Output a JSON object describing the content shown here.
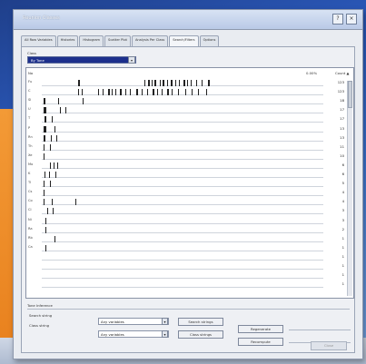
{
  "window": {
    "title": "Reunion Classes"
  },
  "tabs": [
    {
      "label": "All Row Variables"
    },
    {
      "label": "Histories"
    },
    {
      "label": "Histogram"
    },
    {
      "label": "Scatter Plot"
    },
    {
      "label": "Analysis Per Class"
    },
    {
      "label": "Search/Filters",
      "active": true
    },
    {
      "label": "Options"
    }
  ],
  "class_selector": {
    "label": "Class",
    "selected": "By Tone"
  },
  "grid": {
    "col_label": "No",
    "col_pct": "0.00%",
    "col_count": "Count ▲",
    "rows": [
      {
        "label": "Fu",
        "count": "123",
        "ticks": [
          [
            40,
            2
          ],
          [
            113,
            1
          ],
          [
            117,
            2
          ],
          [
            121,
            1
          ],
          [
            124,
            2
          ],
          [
            130,
            1
          ],
          [
            133,
            2
          ],
          [
            138,
            1
          ],
          [
            142,
            2
          ],
          [
            147,
            1
          ],
          [
            151,
            1
          ],
          [
            156,
            2
          ],
          [
            160,
            1
          ],
          [
            164,
            1
          ],
          [
            170,
            1
          ],
          [
            176,
            1
          ],
          [
            183,
            2
          ]
        ]
      },
      {
        "label": "C",
        "count": "123",
        "ticks": [
          [
            40,
            1
          ],
          [
            44,
            1
          ],
          [
            62,
            1
          ],
          [
            67,
            1
          ],
          [
            73,
            2
          ],
          [
            77,
            1
          ],
          [
            81,
            1
          ],
          [
            86,
            2
          ],
          [
            92,
            1
          ],
          [
            97,
            1
          ],
          [
            104,
            2
          ],
          [
            110,
            1
          ],
          [
            116,
            1
          ],
          [
            122,
            2
          ],
          [
            127,
            1
          ],
          [
            132,
            1
          ],
          [
            138,
            2
          ],
          [
            143,
            1
          ],
          [
            150,
            1
          ],
          [
            158,
            1
          ],
          [
            165,
            1
          ],
          [
            172,
            1
          ],
          [
            181,
            1
          ]
        ]
      },
      {
        "label": "Sl",
        "count": "18",
        "ticks": [
          [
            2,
            2
          ],
          [
            18,
            1
          ],
          [
            45,
            1
          ]
        ]
      },
      {
        "label": "U",
        "count": "17",
        "ticks": [
          [
            2,
            3
          ],
          [
            20,
            1
          ],
          [
            26,
            1
          ]
        ]
      },
      {
        "label": "T",
        "count": "17",
        "ticks": [
          [
            3,
            2
          ],
          [
            11,
            1
          ]
        ]
      },
      {
        "label": "P",
        "count": "13",
        "ticks": [
          [
            2,
            3
          ],
          [
            14,
            1
          ]
        ]
      },
      {
        "label": "Rn",
        "count": "13",
        "ticks": [
          [
            2,
            2
          ],
          [
            10,
            1
          ],
          [
            16,
            1
          ]
        ]
      },
      {
        "label": "Th",
        "count": "11",
        "ticks": [
          [
            2,
            1
          ],
          [
            9,
            1
          ]
        ]
      },
      {
        "label": "Xe",
        "count": "10",
        "ticks": [
          [
            2,
            1
          ]
        ]
      },
      {
        "label": "Mo",
        "count": "6",
        "ticks": [
          [
            9,
            1
          ],
          [
            13,
            1
          ],
          [
            17,
            1
          ]
        ]
      },
      {
        "label": "K",
        "count": "6",
        "ticks": [
          [
            3,
            1
          ],
          [
            8,
            1
          ],
          [
            15,
            1
          ]
        ]
      },
      {
        "label": "Tl",
        "count": "5",
        "ticks": [
          [
            2,
            1
          ],
          [
            9,
            1
          ]
        ]
      },
      {
        "label": "Cs",
        "count": "4",
        "ticks": [
          [
            2,
            1
          ]
        ]
      },
      {
        "label": "Co",
        "count": "4",
        "ticks": [
          [
            2,
            1
          ],
          [
            11,
            1
          ],
          [
            37,
            1
          ]
        ]
      },
      {
        "label": "Cl",
        "count": "3",
        "ticks": [
          [
            6,
            1
          ],
          [
            12,
            1
          ]
        ]
      },
      {
        "label": "Ni",
        "count": "3",
        "ticks": [
          [
            4,
            1
          ]
        ]
      },
      {
        "label": "Ra",
        "count": "2",
        "ticks": [
          [
            4,
            1
          ]
        ]
      },
      {
        "label": "Rb",
        "count": "1",
        "ticks": [
          [
            14,
            1
          ]
        ]
      },
      {
        "label": "Ca",
        "count": "1",
        "ticks": [
          [
            4,
            1
          ]
        ]
      },
      {
        "label": "",
        "count": "1",
        "ticks": []
      },
      {
        "label": "",
        "count": "1",
        "ticks": []
      },
      {
        "label": "",
        "count": "1",
        "ticks": []
      },
      {
        "label": "",
        "count": "1",
        "ticks": []
      }
    ]
  },
  "bottom": {
    "section_label": "Tone Inference",
    "search_label": "Search string",
    "class_label": "Class string",
    "search_value": "Any variables",
    "class_value": "Any variables",
    "search_btn": "Search strings",
    "class_btn": "Class strings",
    "regen_btn": "Regenerate",
    "recompute_btn": "Recompute",
    "ok_btn": "Close"
  }
}
